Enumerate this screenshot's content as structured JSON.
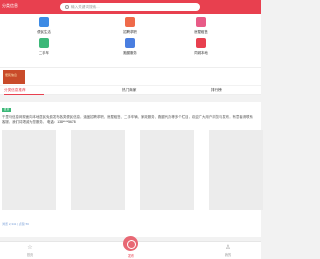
{
  "header": {
    "brand": "分类信息",
    "search_placeholder": "输入关键词搜索…"
  },
  "menu": {
    "items": [
      {
        "label": "便民生活",
        "icon": "life-icon",
        "color": "#3d8be5"
      },
      {
        "label": "招聘求职",
        "icon": "job-icon",
        "color": "#ef6a4a"
      },
      {
        "label": "房屋租售",
        "icon": "house-icon",
        "color": "#e85b87"
      },
      {
        "label": "二手车",
        "icon": "car-icon",
        "color": "#3cb878"
      },
      {
        "label": "跑腿服务",
        "icon": "errand-icon",
        "color": "#4a7ee0"
      },
      {
        "label": "同城本地",
        "icon": "local-icon",
        "color": "#e8404f"
      }
    ]
  },
  "banner": {
    "text": "便民信息"
  },
  "tabs": [
    {
      "label": "分类信息推荐",
      "active": true
    },
    {
      "label": "热门商家",
      "active": false
    },
    {
      "label": "排行榜",
      "active": false
    }
  ],
  "post": {
    "tag": "置顶",
    "text": "千里马信息网现面向本地居民免费发布各类便民信息，涵盖招聘求职、房屋租售、二手车辆、家政服务、跑腿代办等多个栏目，欢迎广大用户浏览与发布，有意者请联系客服，我们将竭诚为您服务。",
    "phone": "电话：138****5678",
    "stats": "浏览 2,341 | 点赞 56"
  },
  "bottom_nav": [
    {
      "label": "首页",
      "icon": "home-icon",
      "active": false
    },
    {
      "label": "发布",
      "icon": "publish-icon",
      "active": true
    },
    {
      "label": "我的",
      "icon": "user-icon",
      "active": false
    }
  ],
  "colors": {
    "accent": "#e8404f",
    "tag": "#3cb878"
  }
}
